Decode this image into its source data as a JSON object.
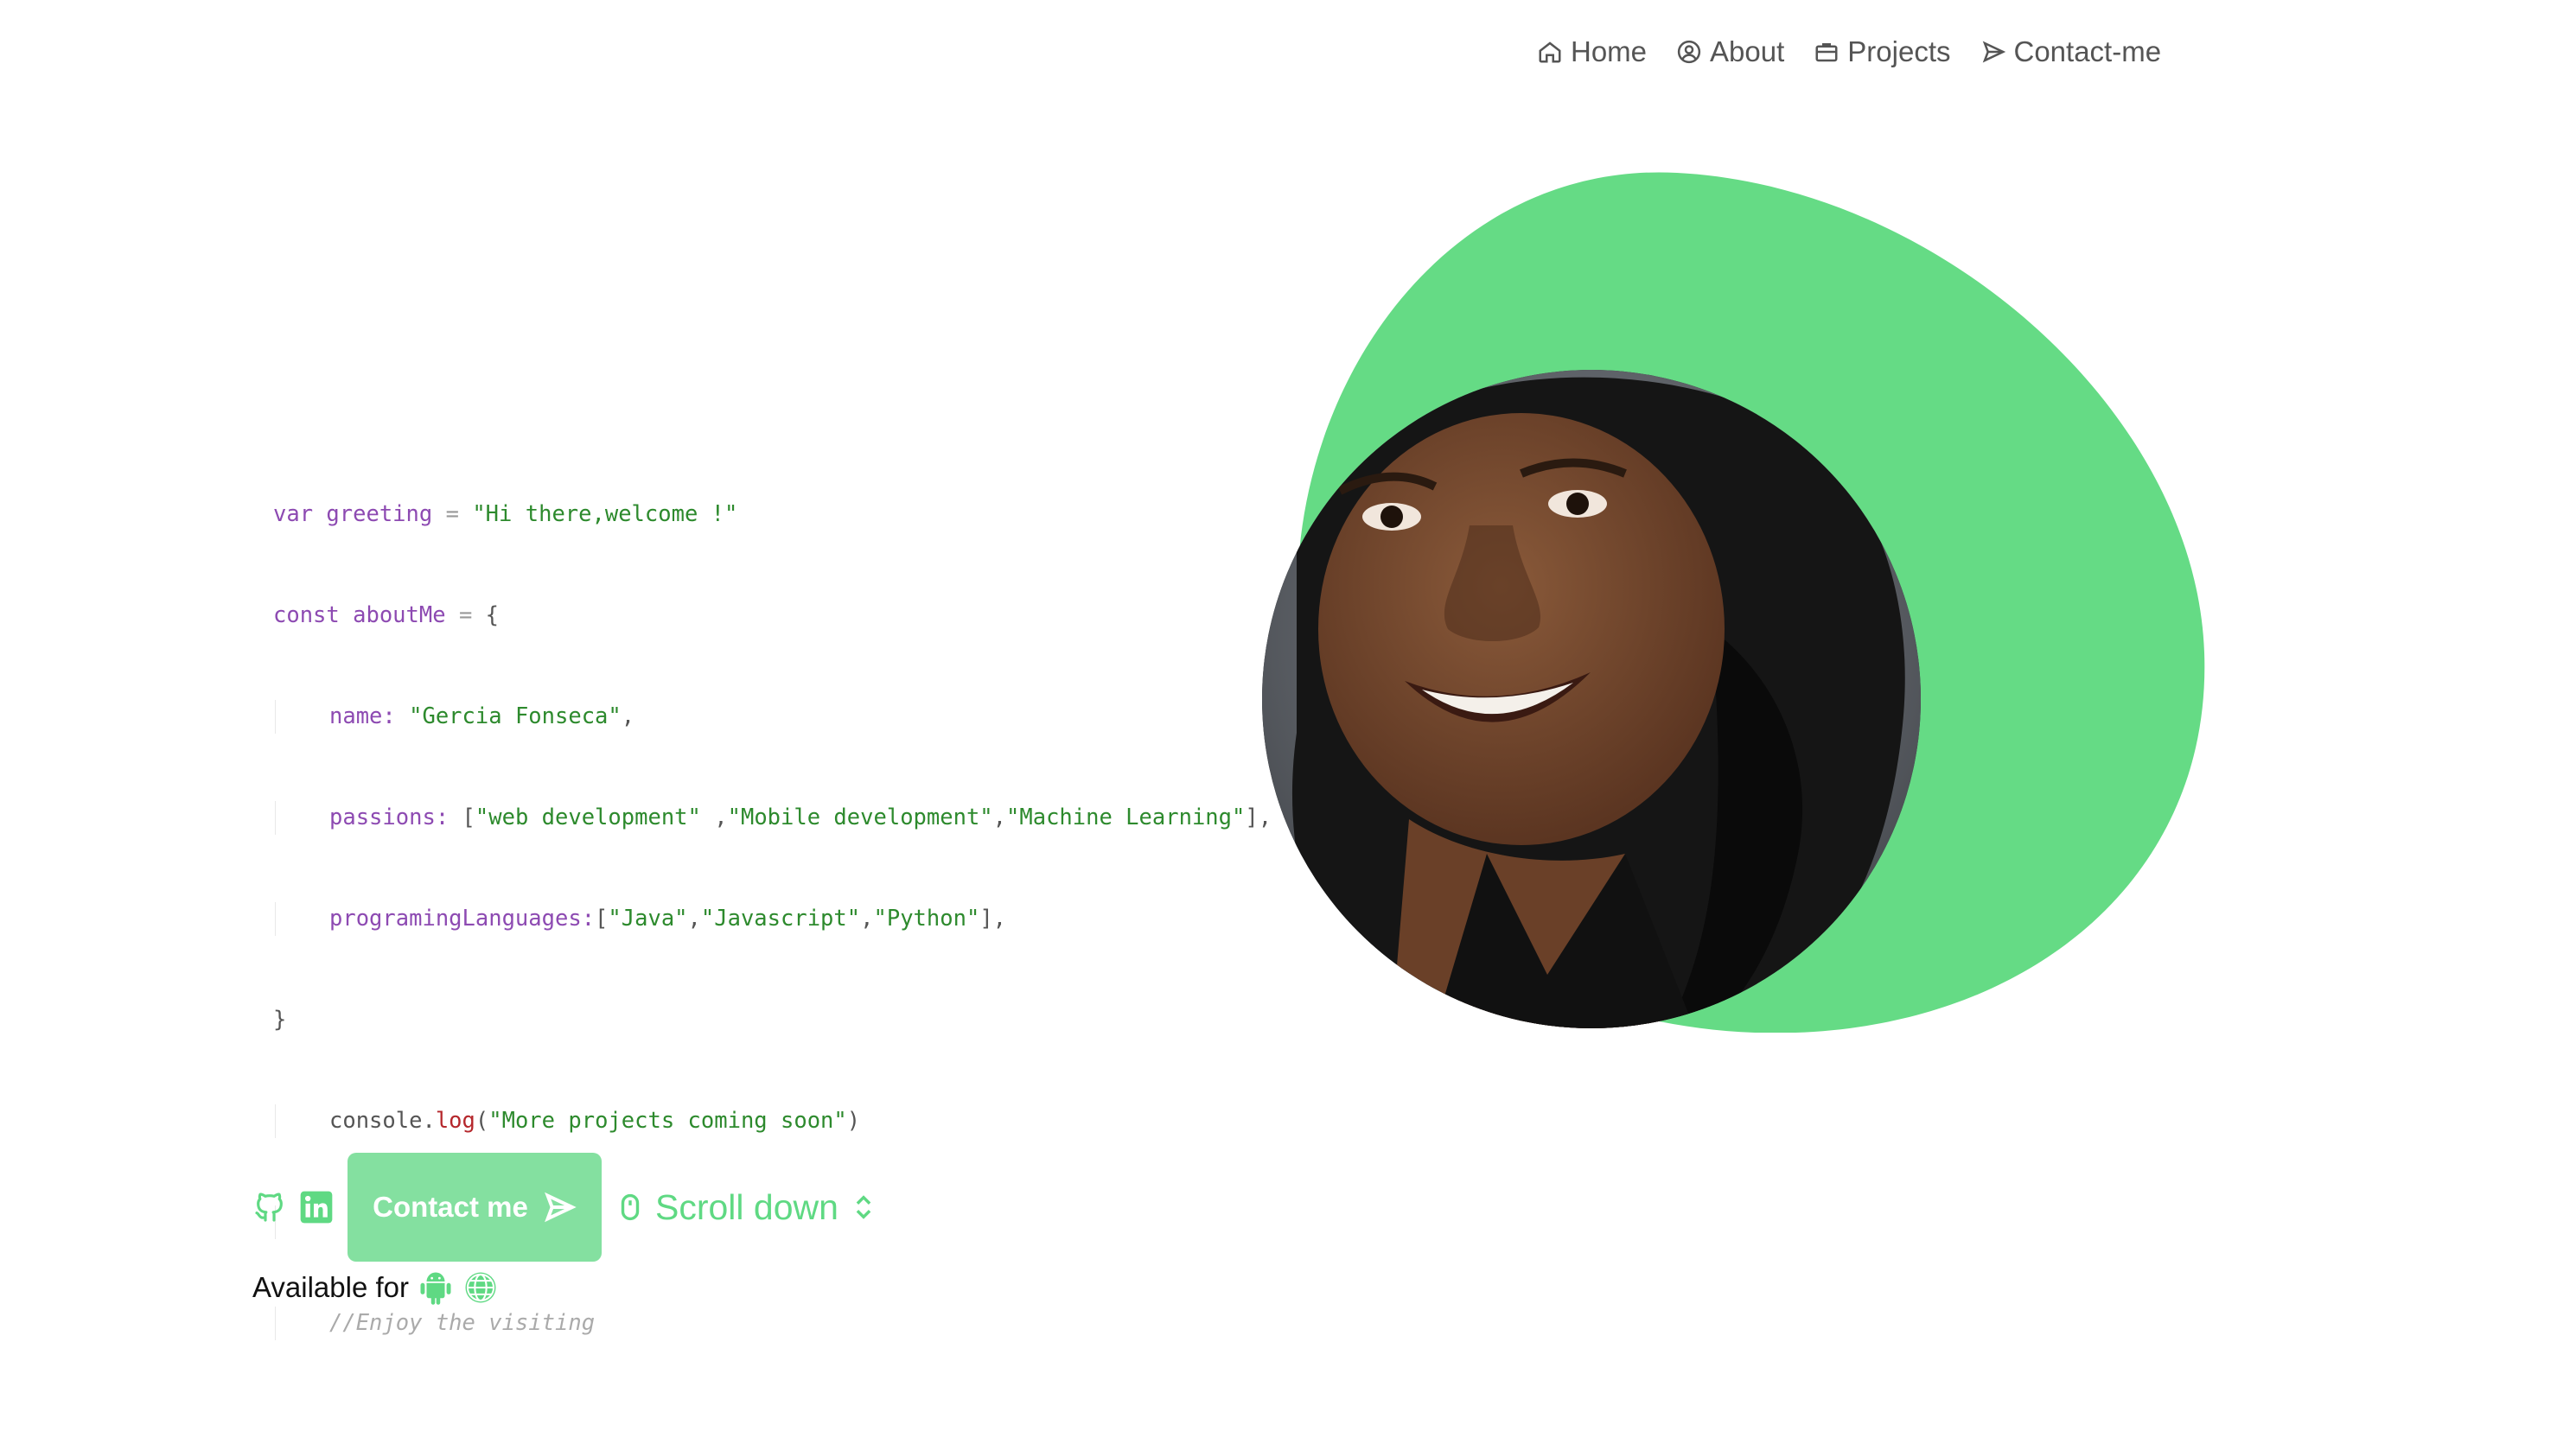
{
  "nav": {
    "items": [
      {
        "label": "Home",
        "icon": "home-icon"
      },
      {
        "label": "About",
        "icon": "user-circle-icon"
      },
      {
        "label": "Projects",
        "icon": "briefcase-icon"
      },
      {
        "label": "Contact-me",
        "icon": "send-icon"
      }
    ]
  },
  "code": {
    "l1": {
      "kw": "var",
      "name": "greeting",
      "op": "=",
      "str": "\"Hi there,welcome !\""
    },
    "l2": {
      "kw": "const",
      "name": "aboutMe",
      "op": "=",
      "brace": "{"
    },
    "l3": {
      "prop": "name:",
      "str": "\"Gercia Fonseca\"",
      "tail": ","
    },
    "l4": {
      "prop": "passions:",
      "open": "[",
      "s1": "\"web development\"",
      "sep1": " ,",
      "s2": "\"Mobile development\"",
      "sep2": ",",
      "s3": "\"Machine Learning\"",
      "close": "],"
    },
    "l5": {
      "prop": "programingLanguages:",
      "open": "[",
      "s1": "\"Java\"",
      "sep1": ",",
      "s2": "\"Javascript\"",
      "sep2": ",",
      "s3": "\"Python\"",
      "close": "],"
    },
    "l6": {
      "brace": "}"
    },
    "l7": {
      "obj": "console.",
      "fn": "log",
      "open": "(",
      "str": "\"More projects coming soon\"",
      "close": ")"
    },
    "l9": {
      "comment": "//Enjoy the visiting"
    }
  },
  "hero": {
    "accent_color": "#65db85",
    "photo": "portrait-photo"
  },
  "actions": {
    "social": [
      "github-icon",
      "linkedin-icon"
    ],
    "contact_label": "Contact me",
    "scroll_label": "Scroll down"
  },
  "available": {
    "label": "Available for",
    "platforms": [
      "android-icon",
      "globe-icon"
    ]
  }
}
